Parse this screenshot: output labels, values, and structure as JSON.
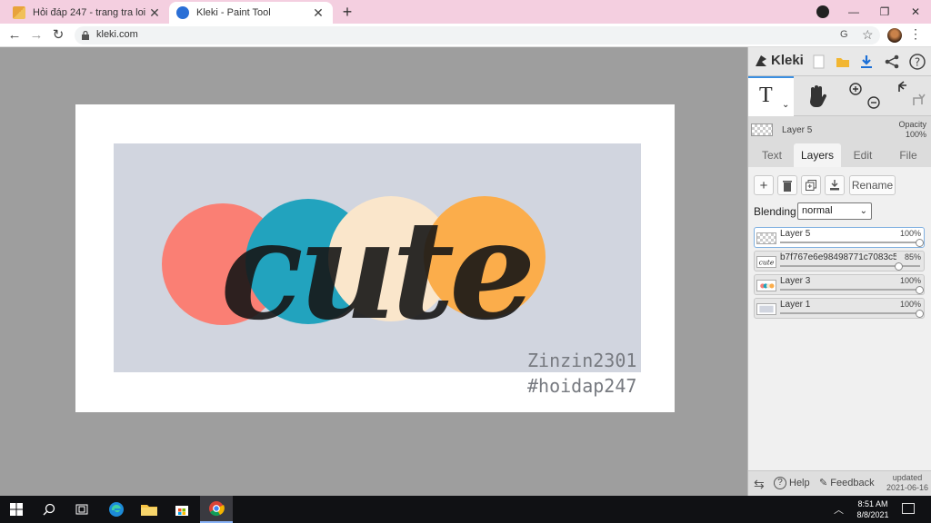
{
  "browser": {
    "tabs": [
      {
        "title": "Hỏi đáp 247 - trang tra loi",
        "active": false
      },
      {
        "title": "Kleki - Paint Tool",
        "active": true
      }
    ],
    "url": "kleki.com"
  },
  "artwork": {
    "word": "cute",
    "watermark_line1": "Zinzin2301",
    "watermark_line2": "#hoidap247",
    "circle_colors": [
      "#fa7f74",
      "#22a3be",
      "#fae6cb",
      "#fbad4b"
    ],
    "background_color": "#d1d5df"
  },
  "kleki": {
    "logo": "Kleki",
    "header_layer_name": "Layer 5",
    "opacity_label": "Opacity",
    "opacity_value": "100%",
    "panel_tabs": [
      "Text",
      "Layers",
      "Edit",
      "File"
    ],
    "rename_label": "Rename",
    "blending_label": "Blending",
    "blending_value": "normal",
    "layers": [
      {
        "name": "Layer 5",
        "opacity": "100%",
        "opacity_fraction": 1.0,
        "active": true
      },
      {
        "name": "b7f767e6e98498771c7083c5",
        "opacity": "85%",
        "opacity_fraction": 0.85,
        "active": false
      },
      {
        "name": "Layer 3",
        "opacity": "100%",
        "opacity_fraction": 1.0,
        "active": false
      },
      {
        "name": "Layer 1",
        "opacity": "100%",
        "opacity_fraction": 1.0,
        "active": false
      }
    ],
    "help_label": "Help",
    "feedback_label": "Feedback",
    "updated_label": "updated",
    "updated_date": "2021-06-16"
  },
  "taskbar": {
    "time": "8:51 AM",
    "date": "8/8/2021"
  }
}
